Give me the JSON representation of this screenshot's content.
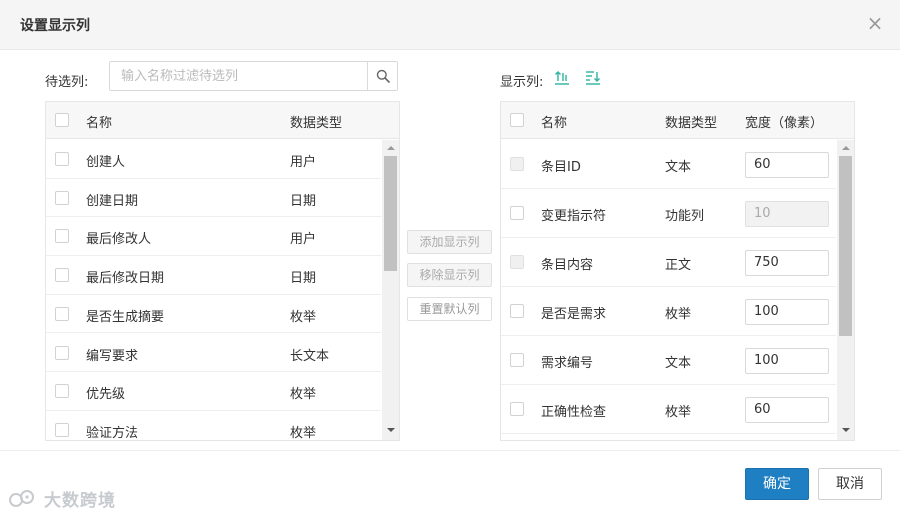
{
  "dialog": {
    "title": "设置显示列",
    "close_glyph": "×"
  },
  "left": {
    "label": "待选列:",
    "search_placeholder": "输入名称过滤待选列",
    "headers": {
      "name": "名称",
      "type": "数据类型"
    },
    "rows": [
      {
        "name": "创建人",
        "type": "用户"
      },
      {
        "name": "创建日期",
        "type": "日期"
      },
      {
        "name": "最后修改人",
        "type": "用户"
      },
      {
        "name": "最后修改日期",
        "type": "日期"
      },
      {
        "name": "是否生成摘要",
        "type": "枚举"
      },
      {
        "name": "编写要求",
        "type": "长文本"
      },
      {
        "name": "优先级",
        "type": "枚举"
      },
      {
        "name": "验证方法",
        "type": "枚举"
      }
    ]
  },
  "middle": {
    "add_label": "添加显示列",
    "remove_label": "移除显示列",
    "reset_label": "重置默认列"
  },
  "right": {
    "label": "显示列:",
    "sort_asc_icon": "sort-ascending-icon",
    "sort_desc_icon": "sort-descending-icon",
    "headers": {
      "name": "名称",
      "type": "数据类型",
      "width": "宽度（像素）"
    },
    "rows": [
      {
        "name": "条目ID",
        "type": "文本",
        "width": "60",
        "disabled_checkbox": true,
        "width_disabled": false
      },
      {
        "name": "变更指示符",
        "type": "功能列",
        "width": "10",
        "disabled_checkbox": false,
        "width_disabled": true
      },
      {
        "name": "条目内容",
        "type": "正文",
        "width": "750",
        "disabled_checkbox": true,
        "width_disabled": false
      },
      {
        "name": "是否是需求",
        "type": "枚举",
        "width": "100",
        "disabled_checkbox": false,
        "width_disabled": false
      },
      {
        "name": "需求编号",
        "type": "文本",
        "width": "100",
        "disabled_checkbox": false,
        "width_disabled": false
      },
      {
        "name": "正确性检查",
        "type": "枚举",
        "width": "60",
        "disabled_checkbox": false,
        "width_disabled": false
      }
    ]
  },
  "footer": {
    "ok_label": "确定",
    "cancel_label": "取消"
  },
  "watermark": {
    "text": "大数跨境"
  },
  "colors": {
    "primary": "#1e7fc2",
    "sort_icon": "#2bb3a3"
  }
}
